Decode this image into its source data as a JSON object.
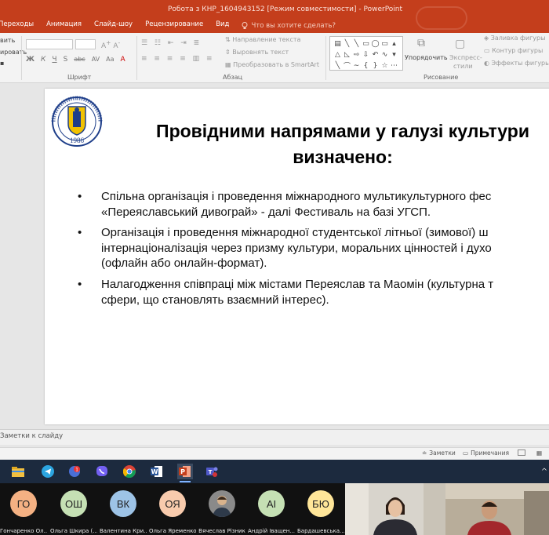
{
  "window": {
    "title": "Робота з КНР_1604943152 [Режим совместимости] - PowerPoint"
  },
  "tabs": [
    "Переходы",
    "Анимация",
    "Слайд-шоу",
    "Рецензирование",
    "Вид"
  ],
  "tell_me": "Что вы хотите сделать?",
  "ribbon": {
    "clipboard_top": "вить",
    "clipboard_mid": "ировать",
    "font_group": "Шрифт",
    "paragraph_group": "Абзац",
    "drawing_group": "Рисование",
    "text_direction": "Направление текста",
    "align_text": "Выровнять текст",
    "convert_smartart": "Преобразовать в SmartArt",
    "arrange": "Упорядочить",
    "quick_styles_line1": "Экспресс-",
    "quick_styles_line2": "стили",
    "shape_fill": "Заливка фигуры",
    "shape_outline": "Контур фигуры",
    "shape_effects": "Эффекты фигуры",
    "format_row": [
      "Ж",
      "К",
      "Ч",
      "S",
      "abc",
      "AV",
      "Aa",
      "A"
    ]
  },
  "slide": {
    "logo_year": "1986",
    "title_line1": "Провідними напрямами у галузі культури",
    "title_line2": "визначено:",
    "bullets": [
      {
        "lines": [
          "Спільна організація і проведення міжнародного мультикультурного фес",
          "«Переяславський дивограй» - далі Фестиваль на базі УГСП."
        ]
      },
      {
        "lines": [
          "Організація і проведення міжнародної студентської літньої (зимової) ш",
          "інтернаціоналізація через призму культури, моральних цінностей і духо",
          "(офлайн або онлайн-формат)."
        ]
      },
      {
        "lines": [
          "Налагодження співпраці між містами Переяслав та Маомін (культурна т",
          "сфери, що становлять взаємний інтерес)."
        ]
      }
    ]
  },
  "notes": {
    "placeholder": "Заметки к слайду"
  },
  "status": {
    "notes": "Заметки",
    "comments": "Примечания"
  },
  "taskbar": {
    "badge_count": "1"
  },
  "participants": [
    {
      "initials": "ГО",
      "name": "Гончаренко Ол...",
      "color": "#f4b183"
    },
    {
      "initials": "ОШ",
      "name": "Ольга Шкира (...",
      "color": "#c5e0b4"
    },
    {
      "initials": "ВК",
      "name": "Валентина Кри...",
      "color": "#9dc3e6"
    },
    {
      "initials": "ОЯ",
      "name": "Ольга Яременко",
      "color": "#f8cbad"
    },
    {
      "initials": "",
      "name": "Вячеслав Різник",
      "color": "#666666"
    },
    {
      "initials": "АІ",
      "name": "Андрій Іващен...",
      "color": "#c5e0b4"
    },
    {
      "initials": "БЮ",
      "name": "Бардашевська...",
      "color": "#ffe699"
    }
  ],
  "colors": {
    "accent": "#c43e1c",
    "taskbar": "#1c2a3e"
  }
}
